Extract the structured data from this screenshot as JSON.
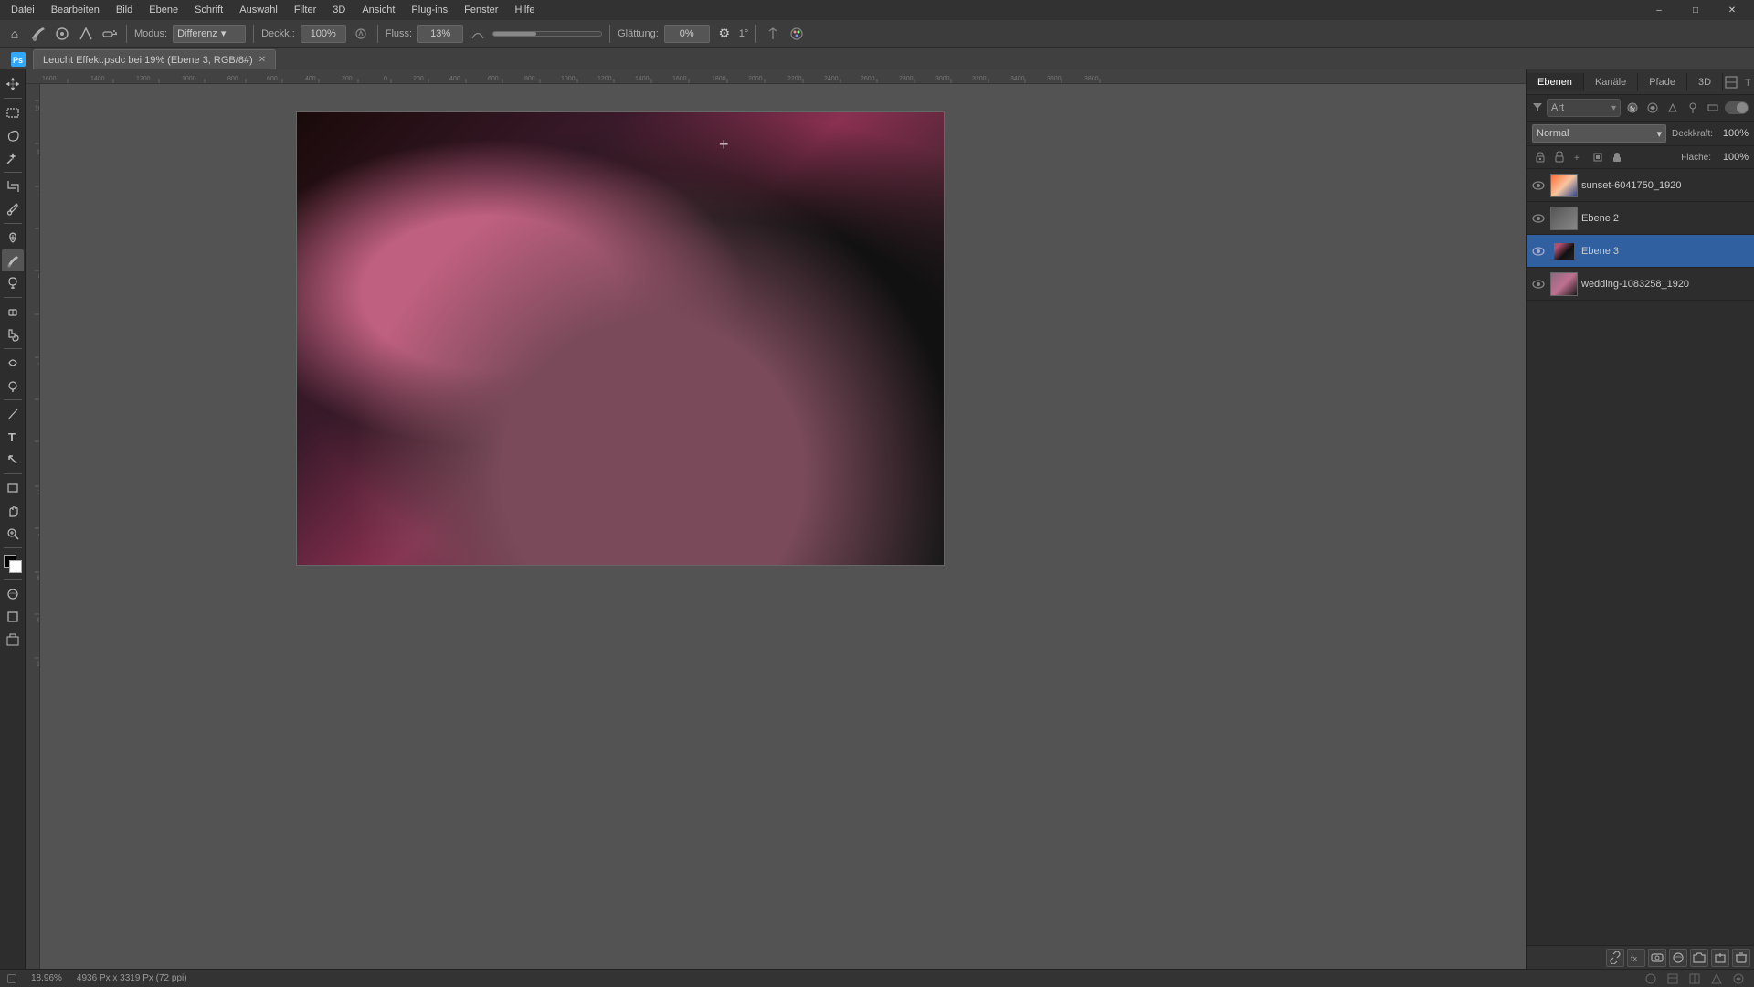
{
  "app": {
    "title": "Adobe Photoshop"
  },
  "menu": {
    "items": [
      "Datei",
      "Bearbeiten",
      "Bild",
      "Ebene",
      "Schrift",
      "Auswahl",
      "Filter",
      "3D",
      "Ansicht",
      "Plug-ins",
      "Fenster",
      "Hilfe"
    ]
  },
  "window_controls": {
    "minimize": "–",
    "maximize": "□",
    "close": "✕"
  },
  "options_bar": {
    "home_label": "⌂",
    "brush_icon": "🖌",
    "modus_label": "Modus:",
    "modus_value": "Differenz",
    "deckk_label": "Deckk.:",
    "deckk_value": "100%",
    "fluss_label": "Fluss:",
    "fluss_value": "13%",
    "glattung_label": "Glättung:",
    "glattung_value": "0%"
  },
  "document": {
    "tab_label": "Leucht Effekt.psdc bei 19% (Ebene 3, RGB/8#)",
    "tab_close": "✕"
  },
  "layers_panel": {
    "tabs": [
      "Ebenen",
      "Kanäle",
      "Pfade",
      "3D"
    ],
    "active_tab": "Ebenen",
    "filter_label": "Art",
    "blend_mode": "Normal",
    "opacity_label": "Deckkraft:",
    "opacity_value": "100%",
    "fill_label": "Fläche:",
    "fill_value": "100%",
    "layers": [
      {
        "name": "sunset-6041750_1920",
        "visible": true,
        "thumb_class": "thumb-sunset"
      },
      {
        "name": "Ebene 2",
        "visible": true,
        "thumb_class": "thumb-ebene2"
      },
      {
        "name": "Ebene 3",
        "visible": true,
        "active": true,
        "thumb_class": "thumb-ebene3"
      },
      {
        "name": "wedding-1083258_1920",
        "visible": true,
        "thumb_class": "thumb-wedding"
      }
    ]
  },
  "status_bar": {
    "zoom": "18.96%",
    "dimensions": "4936 Px x 3319 Px (72 ppi)",
    "indicator": ""
  },
  "icons": {
    "eye": "👁",
    "search": "🔍",
    "arrow_down": "▾",
    "lock": "🔒",
    "fx": "fx",
    "new_layer": "+",
    "delete_layer": "🗑",
    "link": "🔗",
    "mask": "◻",
    "adjustment": "◑"
  }
}
